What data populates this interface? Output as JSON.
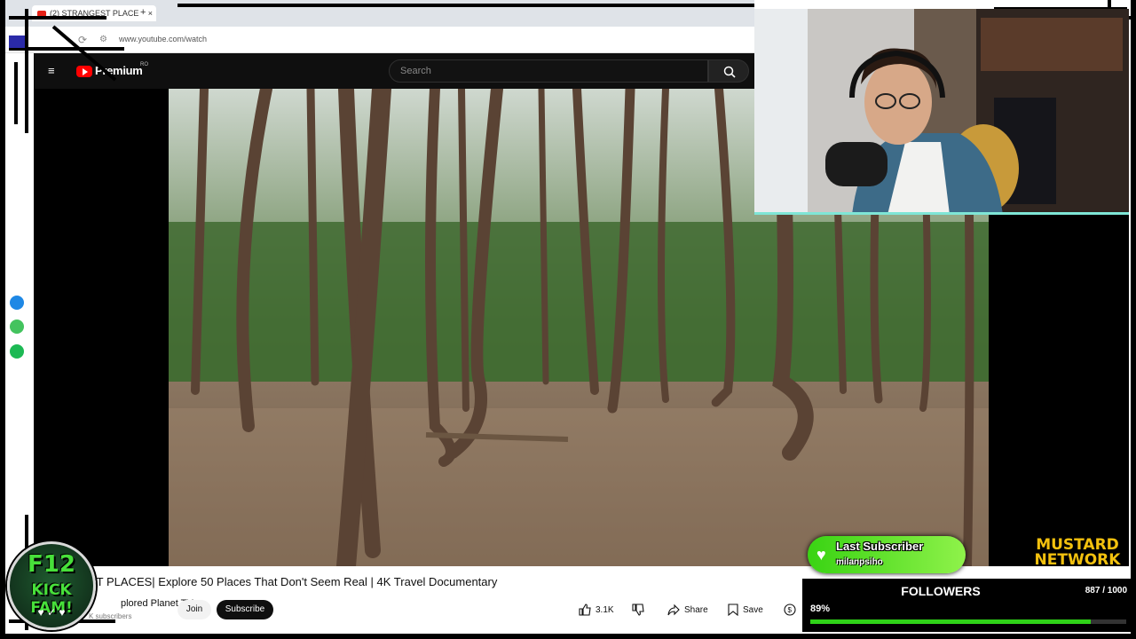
{
  "browser": {
    "tab_title": "(2) STRANGEST PLACE",
    "new_tab": "+",
    "url": "www.youtube.com/watch"
  },
  "youtube": {
    "logo_text": "Premium",
    "region": "RO",
    "search_placeholder": "Search",
    "video_title": "ST PLACES| Explore 50 Places That Don't Seem Real | 4K Travel Documentary",
    "channel_name": "plored Planet TV",
    "subscriber_count": "K subscribers",
    "join_label": "Join",
    "subscribe_label": "Subscribe",
    "like_count": "3.1K",
    "share_label": "Share",
    "save_label": "Save"
  },
  "overlay": {
    "last_subscriber_label": "Last Subscriber",
    "last_subscriber_name": "milanpsiho",
    "followers_label": "FOLLOWERS",
    "followers_count": "887 / 1000",
    "followers_percent_text": "89%",
    "followers_progress": 0.887,
    "brand_line1": "MUSTARD",
    "brand_line2": "NETWORK",
    "badge_line1": "F12",
    "badge_line2": "KICK FAM!",
    "badge_hearts": "♥ ✓ ♥"
  },
  "colors": {
    "accent_green": "#2fd218",
    "youtube_red": "#ff0000",
    "mustard": "#f3c10e",
    "webcam_border": "#7fe6d6"
  }
}
